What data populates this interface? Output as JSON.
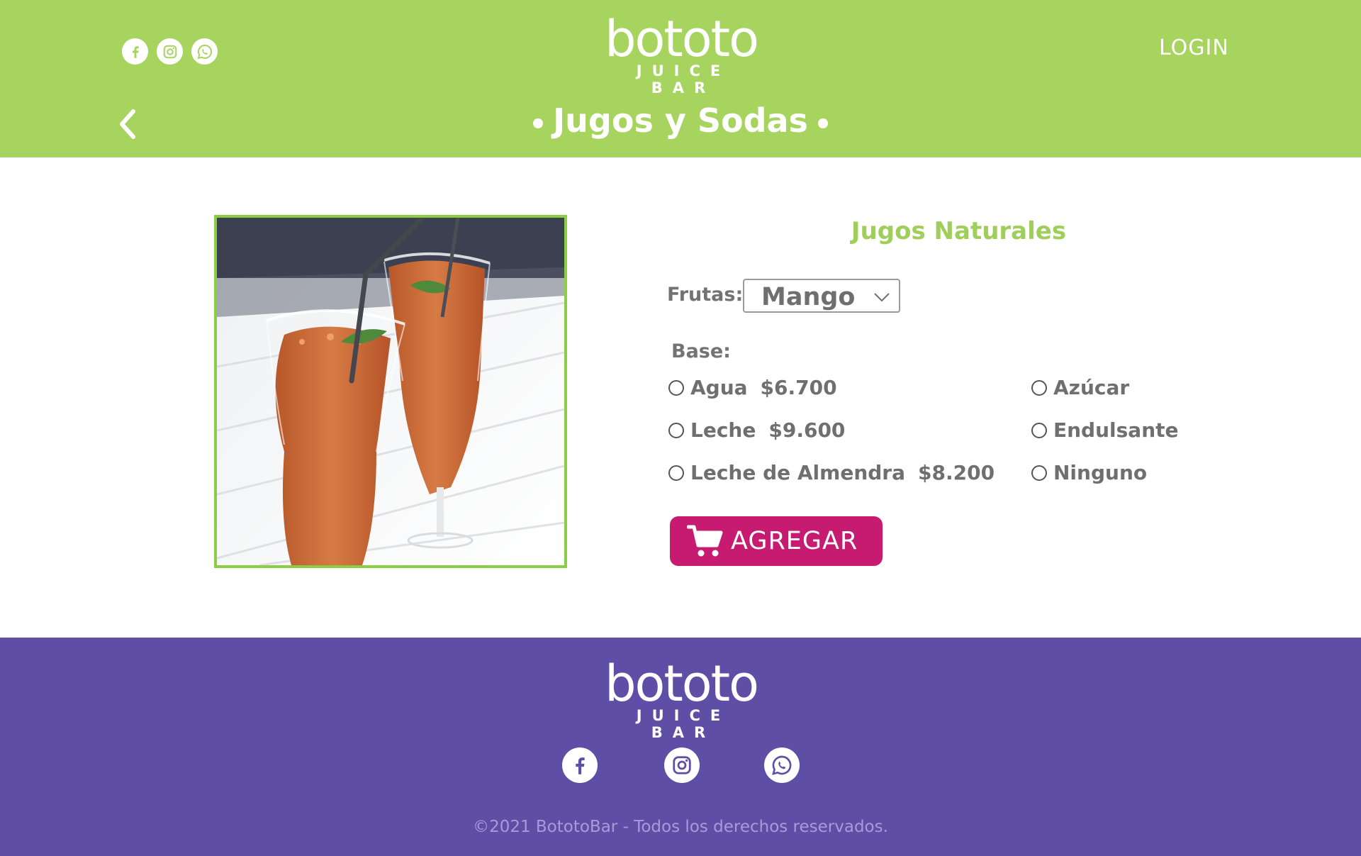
{
  "brand": {
    "wordmark": "bototo",
    "tagline": "JUICE BAR"
  },
  "header": {
    "login_label": "LOGIN",
    "category_title": "Jugos y Sodas",
    "social_icons": [
      "facebook-icon",
      "instagram-icon",
      "whatsapp-icon"
    ]
  },
  "product": {
    "title": "Jugos Naturales",
    "image_alt_icon": "juice-glasses-image",
    "fruit_label": "Frutas:",
    "fruit_selected": "Mango",
    "base_label": "Base:",
    "base_options": [
      {
        "label": "Agua",
        "price": "$6.700"
      },
      {
        "label": "Leche",
        "price": "$9.600"
      },
      {
        "label": "Leche de Almendra",
        "price": "$8.200"
      }
    ],
    "sweetener_options": [
      "Azúcar",
      "Endulsante",
      "Ninguno"
    ],
    "add_button_label": "AGREGAR"
  },
  "footer": {
    "copyright": "©2021 BototoBar - Todos los derechos reservados."
  },
  "colors": {
    "header_green": "#a6d45e",
    "title_green": "#9fcf5a",
    "frame_green": "#8dcd46",
    "button_magenta": "#c71b72",
    "footer_purple": "#5e4ea6"
  }
}
